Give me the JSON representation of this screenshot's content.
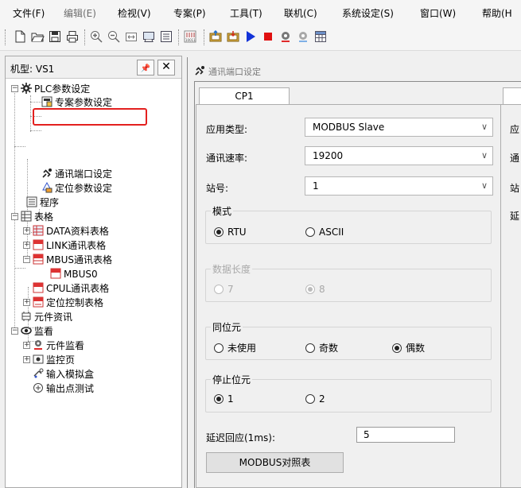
{
  "menu": [
    "文件(F)",
    "编辑(E)",
    "检视(V)",
    "专案(P)",
    "工具(T)",
    "联机(C)",
    "系统设定(S)",
    "窗口(W)",
    "帮助(H"
  ],
  "toolbar": {
    "icons": [
      "new-file-icon",
      "open-folder-icon",
      "save-icon",
      "print-icon",
      "zoom-in-icon",
      "zoom-out-icon",
      "fit-icon",
      "monitor-icon",
      "list-icon",
      "binary-icon",
      "upload-icon",
      "download-icon",
      "run-icon",
      "stop-icon",
      "monitor-on-icon",
      "monitor-off-icon",
      "table-icon"
    ]
  },
  "left_panel": {
    "title": "机型: VS1",
    "pin": "📌",
    "close": "✕",
    "tree": [
      {
        "label": "PLC参数设定"
      },
      {
        "label": "专案参数设定"
      },
      {
        "label": "通讯端口设定"
      },
      {
        "label": "定位参数设定"
      },
      {
        "label": "程序"
      },
      {
        "label": "表格"
      },
      {
        "label": "DATA资料表格"
      },
      {
        "label": "LINK通讯表格"
      },
      {
        "label": "MBUS通讯表格"
      },
      {
        "label": "MBUS0"
      },
      {
        "label": "CPUL通讯表格"
      },
      {
        "label": "定位控制表格"
      },
      {
        "label": "元件资讯"
      },
      {
        "label": "监看"
      },
      {
        "label": "元件监看"
      },
      {
        "label": "监控页"
      },
      {
        "label": "输入模拟盒"
      },
      {
        "label": "输出点测试"
      }
    ],
    "highlight_color": "#e3201f"
  },
  "doc": {
    "title": "通讯端口设定",
    "tab1": "CP1",
    "app_type_label": "应用类型:",
    "app_type_value": "MODBUS Slave",
    "baud_label": "通讯速率:",
    "baud_value": "19200",
    "station_label": "站号:",
    "station_value": "1",
    "mode_title": "模式",
    "mode_rtu": "RTU",
    "mode_ascii": "ASCII",
    "data_len_title": "数据长度",
    "data_len_7": "7",
    "data_len_8": "8",
    "parity_title": "同位元",
    "parity_none": "未使用",
    "parity_odd": "奇数",
    "parity_even": "偶数",
    "stop_title": "停止位元",
    "stop_1": "1",
    "stop_2": "2",
    "delay_label": "延迟回应(1ms):",
    "delay_value": "5",
    "modbus_button": "MODBUS对照表",
    "right_col": [
      "应",
      "通",
      "站",
      "延"
    ]
  }
}
